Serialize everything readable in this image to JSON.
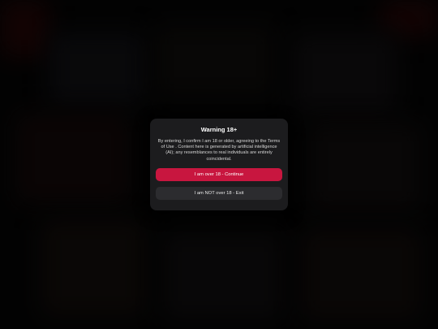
{
  "modal": {
    "title": "Warning 18+",
    "body": "By entering, I confirm I am 18 or older, agreeing to the Terms of Use . Content here is generated by artificial intelligence (AI); any resemblances to real individuals are entirely coincidental.",
    "continue_label": "I am over 18 - Continue",
    "exit_label": "I am NOT over 18 - Exit"
  },
  "colors": {
    "modal_bg": "#1c1c1e",
    "continue_bg": "#c8163f",
    "exit_bg": "#2c2c2f",
    "page_bg": "#060606"
  }
}
